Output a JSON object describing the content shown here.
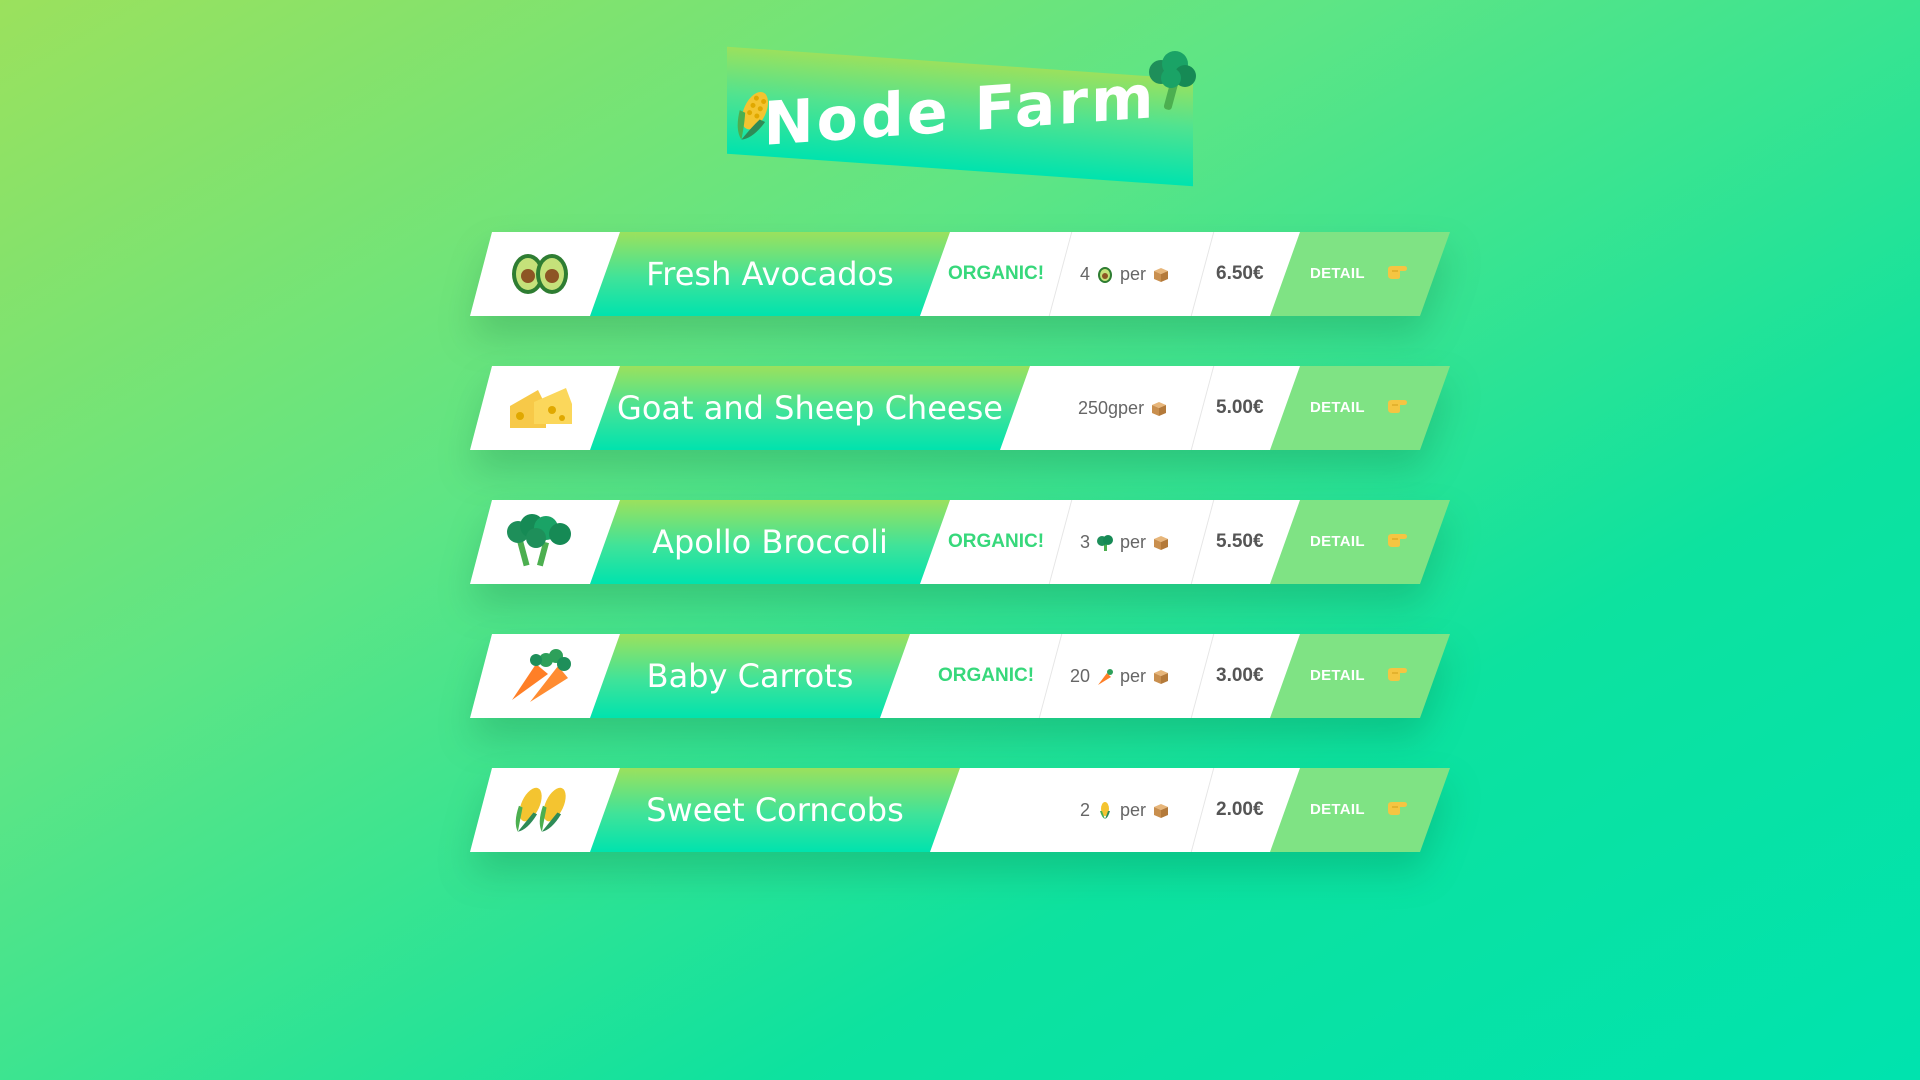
{
  "app": {
    "title": "Node Farm"
  },
  "products": [
    {
      "name": "Fresh Avocados",
      "icon": "avocado-icon",
      "organic": true,
      "organic_label": "ORGANIC!",
      "quantity": "4",
      "per": "per",
      "price": "6.50€",
      "detail_label": "DETAIL"
    },
    {
      "name": "Goat and Sheep Cheese",
      "icon": "cheese-icon",
      "organic": false,
      "organic_label": "",
      "quantity": "250g",
      "per": "per",
      "price": "5.00€",
      "detail_label": "DETAIL"
    },
    {
      "name": "Apollo Broccoli",
      "icon": "broccoli-icon",
      "organic": true,
      "organic_label": "ORGANIC!",
      "quantity": "3",
      "per": "per",
      "price": "5.50€",
      "detail_label": "DETAIL"
    },
    {
      "name": "Baby Carrots",
      "icon": "carrot-icon",
      "organic": true,
      "organic_label": "ORGANIC!",
      "quantity": "20",
      "per": "per",
      "price": "3.00€",
      "detail_label": "DETAIL"
    },
    {
      "name": "Sweet Corncobs",
      "icon": "corn-icon",
      "organic": false,
      "organic_label": "",
      "quantity": "2",
      "per": "per",
      "price": "2.00€",
      "detail_label": "DETAIL"
    }
  ],
  "colors": {
    "accent_green": "#37d87b",
    "detail_green": "#7fe384",
    "background_start": "#9be15d",
    "background_end": "#00e3ae"
  }
}
